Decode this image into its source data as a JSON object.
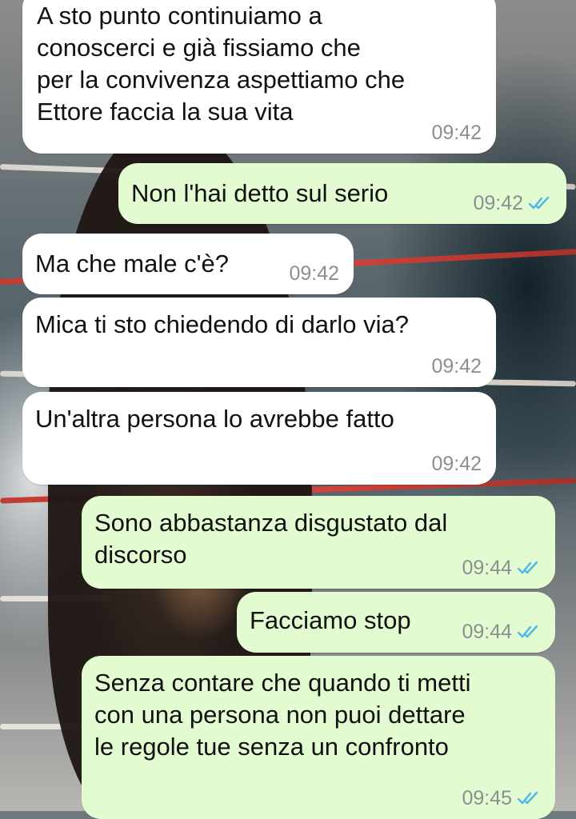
{
  "chat": {
    "messages": [
      {
        "direction": "incoming",
        "text": "A sto punto continuiamo a\nconoscerci e già fissiamo che\nper la convivenza aspettiamo che\nEttore faccia la sua vita",
        "time": "09:42"
      },
      {
        "direction": "outgoing",
        "text": "Non l'hai detto sul serio",
        "time": "09:42",
        "status": "read"
      },
      {
        "direction": "incoming",
        "text": "Ma che male c'è?",
        "time": "09:42"
      },
      {
        "direction": "incoming",
        "text": "Mica ti sto chiedendo di darlo via?",
        "time": "09:42"
      },
      {
        "direction": "incoming",
        "text": "Un'altra persona lo avrebbe fatto",
        "time": "09:42"
      },
      {
        "direction": "outgoing",
        "text": "Sono abbastanza disgustato dal\ndiscorso",
        "time": "09:44",
        "status": "read"
      },
      {
        "direction": "outgoing",
        "text": "Facciamo stop",
        "time": "09:44",
        "status": "read"
      },
      {
        "direction": "outgoing",
        "text": "Senza contare che quando ti metti\ncon una persona non puoi dettare\nle regole tue senza un confronto",
        "time": "09:45",
        "status": "read"
      }
    ]
  },
  "colors": {
    "incoming_bubble": "#ffffff",
    "outgoing_bubble": "#e3fbd0",
    "timestamp": "#8a8f93",
    "read_ticks": "#4fb6ec"
  },
  "icons": {
    "read_receipt": "double-check-icon"
  }
}
